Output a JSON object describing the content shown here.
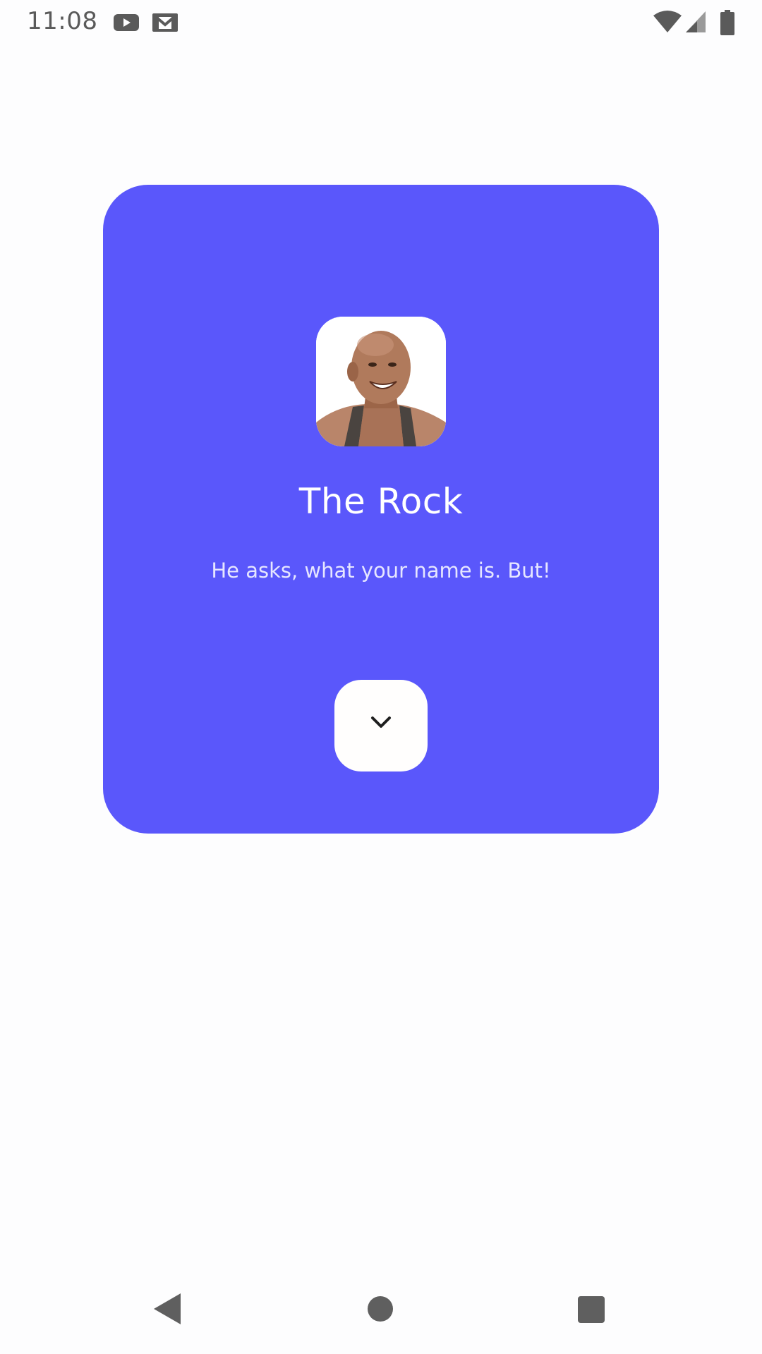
{
  "status_bar": {
    "time": "11:08",
    "notification_icons": [
      "youtube-icon",
      "gmail-icon"
    ],
    "system_icons": [
      "wifi-icon",
      "cellular-signal-icon",
      "battery-icon"
    ]
  },
  "card": {
    "background_color": "#5a57fb",
    "title": "The Rock",
    "subtitle": "He asks, what your name is. But!",
    "avatar_icon": "person-photo",
    "expand_icon": "chevron-down-icon"
  },
  "nav_bar": {
    "icons": [
      "back-icon",
      "home-icon",
      "recents-icon"
    ]
  }
}
